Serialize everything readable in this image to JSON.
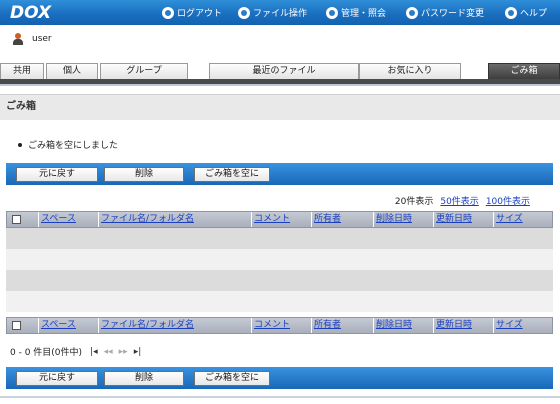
{
  "header": {
    "logo": "DOX",
    "nav": [
      {
        "label": "ログアウト",
        "icon": "logout-icon"
      },
      {
        "label": "ファイル操作",
        "icon": "file-op-icon"
      },
      {
        "label": "管理・照会",
        "icon": "admin-icon"
      },
      {
        "label": "パスワード変更",
        "icon": "refresh-icon"
      },
      {
        "label": "ヘルプ",
        "icon": "help-icon"
      }
    ]
  },
  "user": {
    "name": "user"
  },
  "tabs": {
    "shared": "共用",
    "personal": "個人",
    "group": "グループ",
    "recent": "最近のファイル",
    "favorites": "お気に入り",
    "trash": "ごみ箱"
  },
  "page": {
    "title": "ごみ箱",
    "message": "ごみ箱を空にしました"
  },
  "actions": {
    "restore": "元に戻す",
    "delete": "削除",
    "empty": "ごみ箱を空に"
  },
  "page_size": {
    "current": "20件表示",
    "option50": "50件表示",
    "option100": "100件表示"
  },
  "table": {
    "columns": [
      "スペース",
      "ファイル名/フォルダ名",
      "コメント",
      "所有者",
      "削除日時",
      "更新日時",
      "サイズ"
    ]
  },
  "pager": {
    "summary": "0 - 0 件目(0件中)",
    "first": "|◂",
    "prev": "◂◂",
    "next": "▸▸",
    "last": "▸|"
  },
  "colors": {
    "header_blue": "#1b6fc0",
    "active_tab": "#4a4a4a",
    "link": "#1a3fc0"
  }
}
